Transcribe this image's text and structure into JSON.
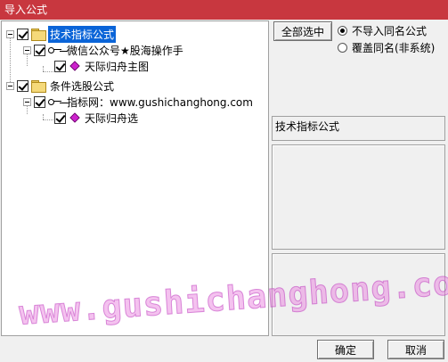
{
  "window": {
    "title": "导入公式"
  },
  "tree": {
    "nodes": [
      {
        "label": "技术指标公式"
      },
      {
        "label": "微信公众号★股海操作手"
      },
      {
        "label": "天际归舟主图"
      },
      {
        "label": "条件选股公式"
      },
      {
        "label": "指标网：www.gushichanghong.com"
      },
      {
        "label": "天际归舟选"
      }
    ]
  },
  "options": {
    "select_all_label": "全部选中",
    "radio_skip_label": "不导入同名公式",
    "radio_overwrite_label": "覆盖同名(非系统)",
    "selected": "不导入同名公式"
  },
  "info": {
    "category_label": "技术指标公式"
  },
  "watermark": {
    "text": "www.gushichanghong.com"
  },
  "footer": {
    "ok_label": "确定",
    "cancel_label": "取消"
  },
  "colors": {
    "titlebar": "#c8373f",
    "selection": "#0a64d8",
    "watermark": "#e678dc"
  }
}
